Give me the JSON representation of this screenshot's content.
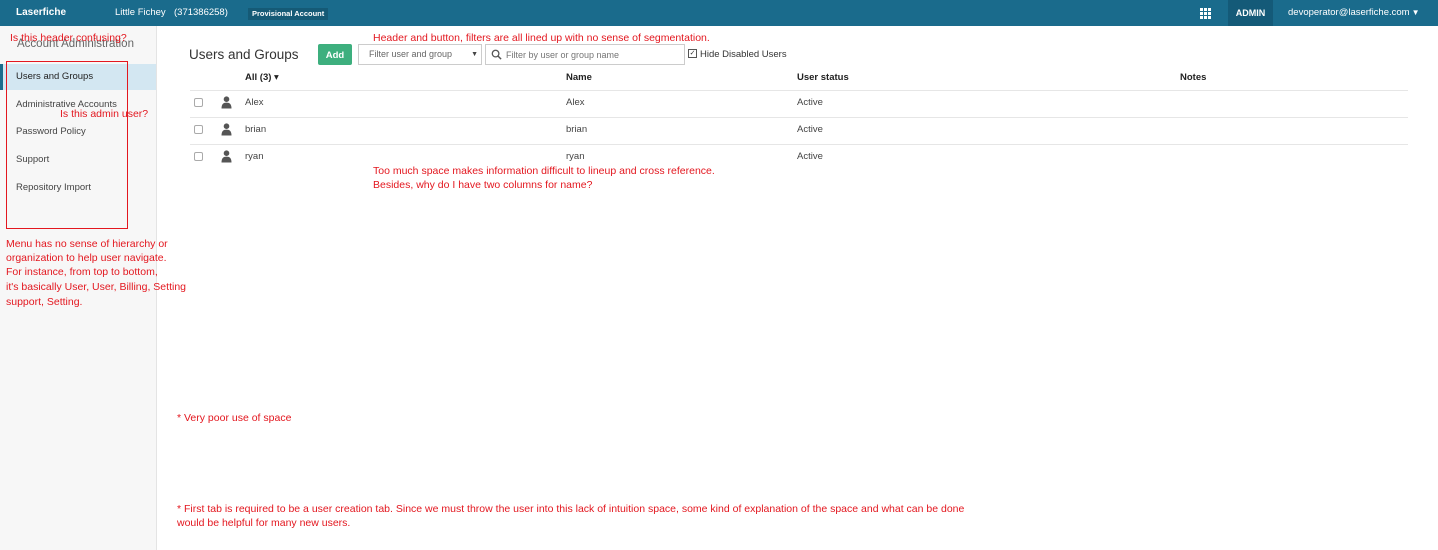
{
  "topbar": {
    "brand": "Laserfiche",
    "org_name": "Little Fichey",
    "org_id": "(371386258)",
    "account_badge": "Provisional Account",
    "admin_label": "ADMIN",
    "user_email": "devoperator@laserfiche.com",
    "color": "#1a6b8c"
  },
  "sidebar": {
    "header": "Account Administration",
    "items": [
      {
        "label": "Users and Groups",
        "active": true
      },
      {
        "label": "Administrative Accounts",
        "active": false
      },
      {
        "label": "Password Policy",
        "active": false
      },
      {
        "label": "Support",
        "active": false
      },
      {
        "label": "Repository Import",
        "active": false
      }
    ]
  },
  "main": {
    "title": "Users and Groups",
    "add_label": "Add",
    "filter_select": "Filter user and group",
    "search_placeholder": "Filter by user or group name",
    "hide_disabled_label": "Hide Disabled Users",
    "hide_disabled_checked": true,
    "columns": {
      "all": "All (3) ▾",
      "name": "Name",
      "status": "User status",
      "notes": "Notes"
    },
    "rows": [
      {
        "display": "Alex",
        "name": "Alex",
        "status": "Active",
        "notes": ""
      },
      {
        "display": "brian",
        "name": "brian",
        "status": "Active",
        "notes": ""
      },
      {
        "display": "ryan",
        "name": "ryan",
        "status": "Active",
        "notes": ""
      }
    ]
  },
  "annotations": {
    "header_confusing": "Is this header confusing?",
    "admin_user": "Is this admin user?",
    "segmentation": "Header and button, filters are all lined up with no sense of segmentation.",
    "space_1": "Too much space makes information difficult to lineup and cross reference.",
    "space_2": "Besides, why do I have two columns for name?",
    "menu_1": "Menu has no sense of hierarchy or",
    "menu_2": "organization to help user navigate.",
    "menu_3": "For instance, from top to bottom,",
    "menu_4": "it's basically User, User, Billing, Setting",
    "menu_5": "support, Setting.",
    "poor_space": "* Very poor use of space",
    "first_tab_1": "* First tab is required to be a user creation tab. Since we must throw the user into this lack of intuition space, some kind of explanation of the space and what can be done",
    "first_tab_2": "would be helpful for many new users.",
    "color": "#e3171f"
  }
}
